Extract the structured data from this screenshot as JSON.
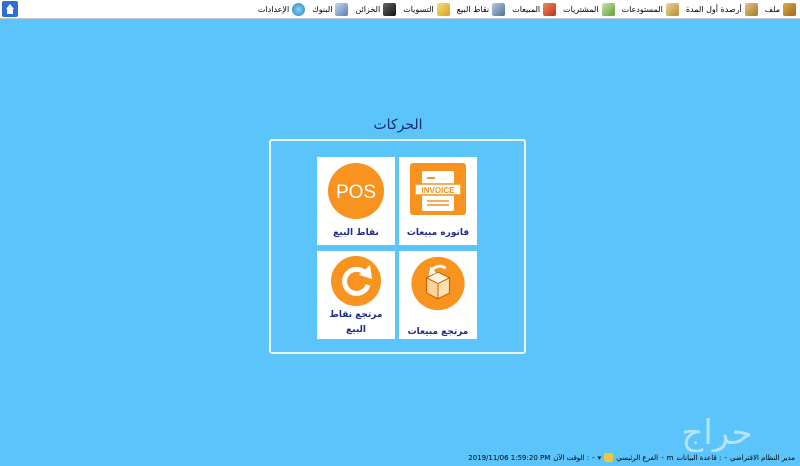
{
  "menu": {
    "items": [
      {
        "id": "file",
        "label": "ملف",
        "icon": "folder-icon",
        "color": "#c98d2a"
      },
      {
        "id": "opening-balances",
        "label": "أرصدة أول المدة",
        "icon": "box-icon",
        "color": "#c9a04a"
      },
      {
        "id": "warehouses",
        "label": "المستودعات",
        "icon": "warehouse-icon",
        "color": "#d8b35a"
      },
      {
        "id": "purchases",
        "label": "المشتريات",
        "icon": "document-icon",
        "color": "#8fbf6a"
      },
      {
        "id": "sales",
        "label": "المبيعات",
        "icon": "cart-icon",
        "color": "#d24b2a"
      },
      {
        "id": "pos",
        "label": "نقاط البيع",
        "icon": "monitor-icon",
        "color": "#6b8fb5"
      },
      {
        "id": "settlements",
        "label": "التسويات",
        "icon": "note-icon",
        "color": "#e9c43d"
      },
      {
        "id": "treasuries",
        "label": "الخزائن",
        "icon": "safe-icon",
        "color": "#333333"
      },
      {
        "id": "banks",
        "label": "البنوك",
        "icon": "bank-icon",
        "color": "#7b9bc8"
      },
      {
        "id": "settings",
        "label": "الإعدادات",
        "icon": "tools-icon",
        "color": "#3aa0d8"
      }
    ]
  },
  "main": {
    "title": "الحركات",
    "tiles": [
      {
        "id": "sales-invoice",
        "label": "فاتوره مبيعات",
        "icon_text": "INVOICE"
      },
      {
        "id": "pos",
        "label": "نقاط البيع",
        "icon_text": "POS"
      },
      {
        "id": "sales-return",
        "label": "مرتجع مبيعات"
      },
      {
        "id": "pos-return",
        "label_line1": "مرتجع نقاط",
        "label_line2": "البيع"
      }
    ]
  },
  "status": {
    "user_label": "مدير النظام الافتراضي",
    "db_label": "قاعدة البيانات :",
    "db_value": "m",
    "branch_label": "الفرع الرئيسي",
    "time_label": "الوقت الآن :",
    "time_value": "2019/11/06 1:59:20 PM"
  },
  "watermark": {
    "text": "حراج"
  },
  "colors": {
    "background": "#5ac4fb",
    "tile_orange": "#f7931e",
    "label_blue": "#1f2a8c"
  }
}
